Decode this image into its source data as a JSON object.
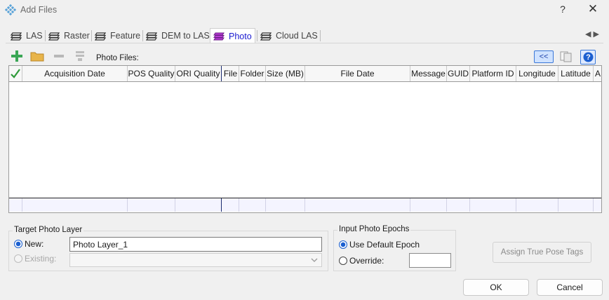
{
  "window": {
    "title": "Add Files",
    "help": "?",
    "close": "✕"
  },
  "tabs": [
    {
      "label": "LAS",
      "icon": "layers-icon"
    },
    {
      "label": "Raster",
      "icon": "layers-icon"
    },
    {
      "label": "Feature",
      "icon": "layers-icon"
    },
    {
      "label": "DEM to LAS",
      "icon": "layers-icon"
    },
    {
      "label": "Photo",
      "icon": "layers-icon",
      "active": true
    },
    {
      "label": "Cloud LAS",
      "icon": "layers-icon"
    }
  ],
  "tab_scroll": {
    "left": "◀",
    "right": "▶"
  },
  "toolbar": {
    "photo_files_label": "Photo Files:",
    "collapse_label": "<<"
  },
  "grid": {
    "columns": [
      "",
      "Acquisition Date",
      "POS Quality",
      "ORI Quality",
      "File",
      "Folder",
      "Size (MB)",
      "File Date",
      "Message",
      "GUID",
      "Platform ID",
      "Longitude",
      "Latitude",
      "A"
    ],
    "rows": []
  },
  "target_layer": {
    "legend": "Target Photo Layer",
    "new_label": "New:",
    "new_value": "Photo Layer_1",
    "existing_label": "Existing:",
    "existing_value": ""
  },
  "epochs": {
    "legend": "Input Photo Epochs",
    "default_label": "Use Default Epoch",
    "override_label": "Override:",
    "override_value": ""
  },
  "buttons": {
    "assign": "Assign True Pose Tags",
    "ok": "OK",
    "cancel": "Cancel"
  },
  "colors": {
    "accent": "#1a5fd0",
    "active_tab_text": "#1a1ad0",
    "add_icon": "#3aa655",
    "folder_icon": "#e8b44a",
    "checkmark": "#2f9a3a",
    "photo_tab_icon": "#b93bd6"
  }
}
